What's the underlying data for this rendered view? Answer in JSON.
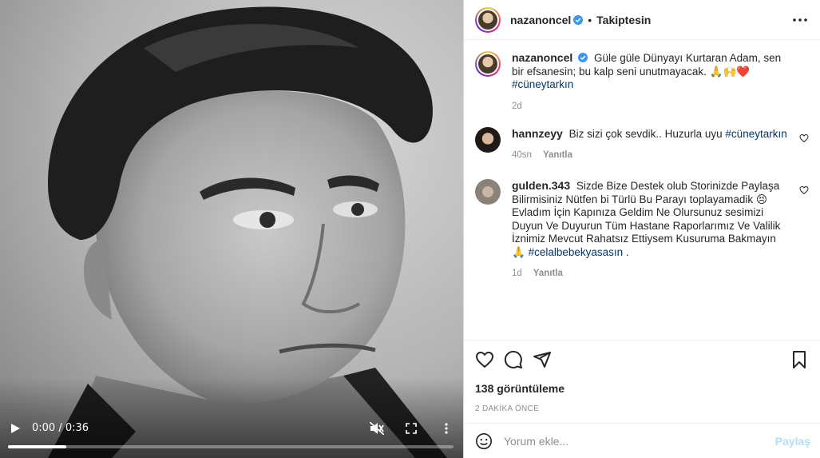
{
  "video": {
    "time": "0:00 / 0:36",
    "progress_fraction": 0.13
  },
  "header": {
    "username": "nazanoncel",
    "dot": "•",
    "follow_state": "Takiptesin"
  },
  "caption": {
    "username": "nazanoncel",
    "text": "Güle güle Dünyayı Kurtaran Adam, sen bir efsanesin; bu kalp seni unutmayacak. 🙏🙌❤️",
    "hashtag": "#cüneytarkın",
    "age": "2d"
  },
  "comments": [
    {
      "username": "hannzeyy",
      "text": "Biz sizi çok sevdik.. Huzurla uyu",
      "hashtag": "#cüneytarkın",
      "suffix": "",
      "age": "40sn",
      "reply": "Yanıtla"
    },
    {
      "username": "gulden.343",
      "text": "Sizde Bize Destek olub Storinizde Paylaşa Bilirmisiniz Nütfen bi Türlü Bu Parayı toplayamadik 😣 Evladım İçin Kapınıza Geldim Ne Olursunuz sesimizi Duyun Ve Duyurun Tüm Hastane Raporlarımız Ve Valilik İznimiz Mevcut Rahatsız Ettiysem Kusuruma Bakmayın 🙏",
      "hashtag": "#celalbebekyasasın",
      "suffix": " .",
      "age": "1d",
      "reply": "Yanıtla"
    }
  ],
  "stats": {
    "views": "138 görüntüleme",
    "posted": "2 DAKİKA ÖNCE"
  },
  "add_comment": {
    "placeholder": "Yorum ekle...",
    "post_label": "Paylaş"
  },
  "icons": {
    "play": "play-icon",
    "mute": "muted-icon",
    "fullscreen": "fullscreen-icon",
    "more": "more-icon",
    "like": "heart-icon",
    "comment": "comment-icon",
    "share": "share-icon",
    "save": "bookmark-icon",
    "emoji": "emoji-icon"
  },
  "colors": {
    "link": "#00376b",
    "verified": "#3897f0",
    "post_disabled": "#b2dffc",
    "muted": "#8e8e8e"
  }
}
